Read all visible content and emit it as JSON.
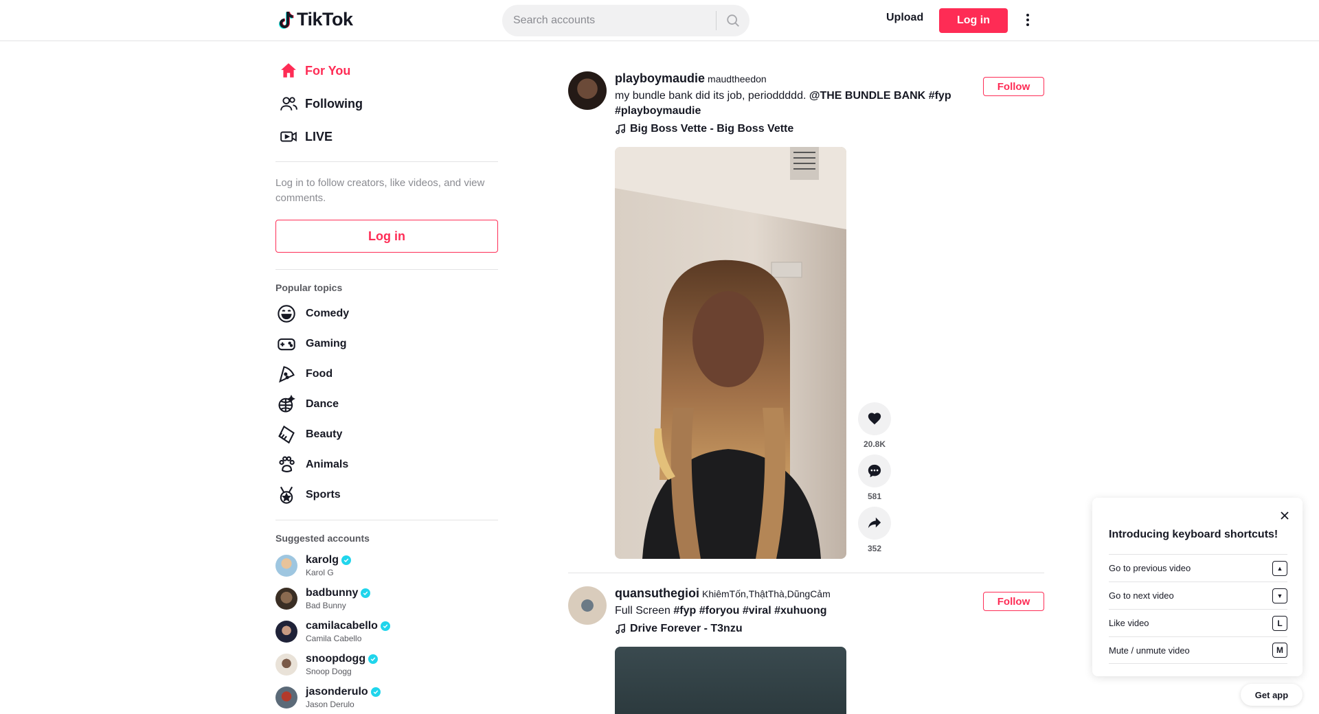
{
  "header": {
    "logo_text": "TikTok",
    "search_placeholder": "Search accounts",
    "upload_label": "Upload",
    "login_label": "Log in"
  },
  "sidebar": {
    "nav": [
      {
        "label": "For You",
        "icon": "home-icon"
      },
      {
        "label": "Following",
        "icon": "following-icon"
      },
      {
        "label": "LIVE",
        "icon": "live-icon"
      }
    ],
    "login_hint": "Log in to follow creators, like videos, and view comments.",
    "login_button": "Log in",
    "popular_title": "Popular topics",
    "topics": [
      {
        "label": "Comedy",
        "icon": "comedy-icon"
      },
      {
        "label": "Gaming",
        "icon": "gaming-icon"
      },
      {
        "label": "Food",
        "icon": "food-icon"
      },
      {
        "label": "Dance",
        "icon": "dance-icon"
      },
      {
        "label": "Beauty",
        "icon": "beauty-icon"
      },
      {
        "label": "Animals",
        "icon": "animals-icon"
      },
      {
        "label": "Sports",
        "icon": "sports-icon"
      }
    ],
    "suggested_title": "Suggested accounts",
    "accounts": [
      {
        "handle": "karolg",
        "name": "Karol G",
        "color": "#c9a27a"
      },
      {
        "handle": "badbunny",
        "name": "Bad Bunny",
        "color": "#5a4a3a"
      },
      {
        "handle": "camilacabello",
        "name": "Camila Cabello",
        "color": "#2b2f45"
      },
      {
        "handle": "snoopdogg",
        "name": "Snoop Dogg",
        "color": "#d8cfc4"
      },
      {
        "handle": "jasonderulo",
        "name": "Jason Derulo",
        "color": "#b33a2a"
      }
    ]
  },
  "posts": [
    {
      "handle": "playboymaudie",
      "name": "maudtheedon",
      "caption_text": "my bundle bank did its job, perioddddd. ",
      "caption_mention": "@THE BUNDLE BANK",
      "caption_tags": "#fyp #playboymaudie",
      "music": "Big Boss Vette - Big Boss Vette",
      "follow_label": "Follow",
      "likes": "20.8K",
      "comments": "581",
      "shares": "352"
    },
    {
      "handle": "quansuthegioi",
      "name": "KhiêmTốn,ThậtThà,DũngCảm",
      "caption_text": "Full Screen ",
      "caption_tags": "#fyp #foryou #viral #xuhuong",
      "music": "Drive Forever - T3nzu",
      "follow_label": "Follow"
    }
  ],
  "keyboard_popup": {
    "title": "Introducing keyboard shortcuts!",
    "rows": [
      {
        "label": "Go to previous video",
        "key": "▲"
      },
      {
        "label": "Go to next video",
        "key": "▼"
      },
      {
        "label": "Like video",
        "key": "L"
      },
      {
        "label": "Mute / unmute video",
        "key": "M"
      }
    ]
  },
  "get_app_label": "Get app",
  "colors": {
    "accent": "#fe2c55",
    "verified": "#20d5ec",
    "text": "#161823",
    "muted": "#8a8b91"
  }
}
